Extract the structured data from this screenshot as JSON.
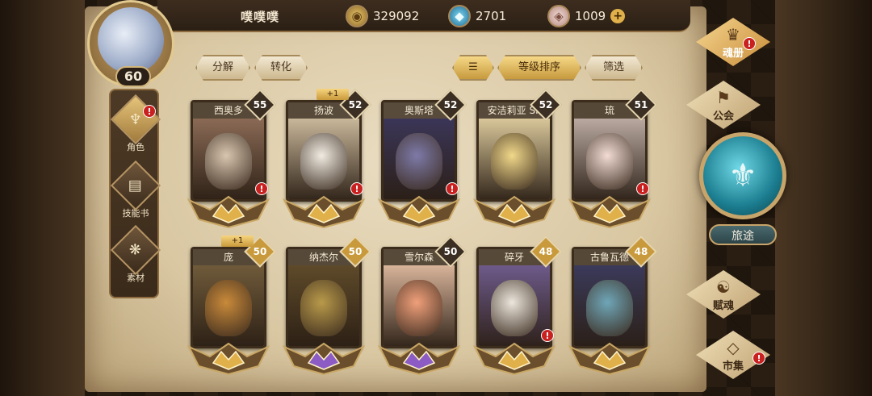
{
  "header": {
    "player_name": "噗噗噗",
    "level": "60",
    "resources": [
      {
        "name": "coin-icon",
        "value": "329092"
      },
      {
        "name": "crystal-icon",
        "value": "2701"
      },
      {
        "name": "gem-icon",
        "value": "1009"
      }
    ]
  },
  "left_nav": [
    {
      "label": "角色",
      "icon": "character-icon",
      "active": true,
      "alert": true
    },
    {
      "label": "技能书",
      "icon": "skill-book-icon",
      "active": false,
      "alert": false
    },
    {
      "label": "素材",
      "icon": "material-icon",
      "active": false,
      "alert": false
    }
  ],
  "toolbar": {
    "decompose": "分解",
    "convert": "转化",
    "sort_icon": "sort-icon",
    "level_sort": "等级排序",
    "filter": "筛选"
  },
  "cards": [
    {
      "name": "西奥多",
      "level": "55",
      "gold_level": false,
      "plus": "",
      "alert": true,
      "portrait": "#d9c6b0",
      "bg": "#8a6a55",
      "crest": "gold"
    },
    {
      "name": "扬波",
      "level": "52",
      "gold_level": false,
      "plus": "+1",
      "alert": true,
      "portrait": "#f1ece2",
      "bg": "#c9b79a",
      "crest": "gold"
    },
    {
      "name": "奥斯塔",
      "level": "52",
      "gold_level": false,
      "plus": "",
      "alert": true,
      "portrait": "#7d7aa8",
      "bg": "#3b3658",
      "crest": "gold"
    },
    {
      "name": "安洁莉亚 SP",
      "level": "52",
      "gold_level": false,
      "plus": "",
      "alert": false,
      "portrait": "#f1d88a",
      "bg": "#d9c79a",
      "crest": "gold"
    },
    {
      "name": "琉",
      "level": "51",
      "gold_level": false,
      "plus": "",
      "alert": true,
      "portrait": "#f2dcd4",
      "bg": "#b9a9a0",
      "crest": "gold"
    },
    {
      "name": "庞",
      "level": "50",
      "gold_level": true,
      "plus": "+1",
      "alert": false,
      "portrait": "#c98a3a",
      "bg": "#6f5a3a",
      "crest": "gold"
    },
    {
      "name": "纳杰尔",
      "level": "50",
      "gold_level": true,
      "plus": "",
      "alert": false,
      "portrait": "#b99a4a",
      "bg": "#5e4a2a",
      "crest": "purple"
    },
    {
      "name": "雪尔森",
      "level": "50",
      "gold_level": false,
      "plus": "",
      "alert": false,
      "portrait": "#f0a07a",
      "bg": "#d8b49a",
      "crest": "purple"
    },
    {
      "name": "碎牙",
      "level": "48",
      "gold_level": true,
      "plus": "",
      "alert": true,
      "portrait": "#ece6dc",
      "bg": "#6e5a8a",
      "crest": "gold"
    },
    {
      "name": "古鲁瓦德",
      "level": "48",
      "gold_level": true,
      "plus": "",
      "alert": false,
      "portrait": "#6fa6b8",
      "bg": "#3b3a5a",
      "crest": "gold"
    }
  ],
  "right_nav": {
    "soul_book": "魂册",
    "guild": "公会",
    "journey": "旅途",
    "talent": "赋魂",
    "market": "市集"
  },
  "colors": {
    "gold": "#e0b04a",
    "purple": "#8c5cc4",
    "alert": "#c92020"
  }
}
